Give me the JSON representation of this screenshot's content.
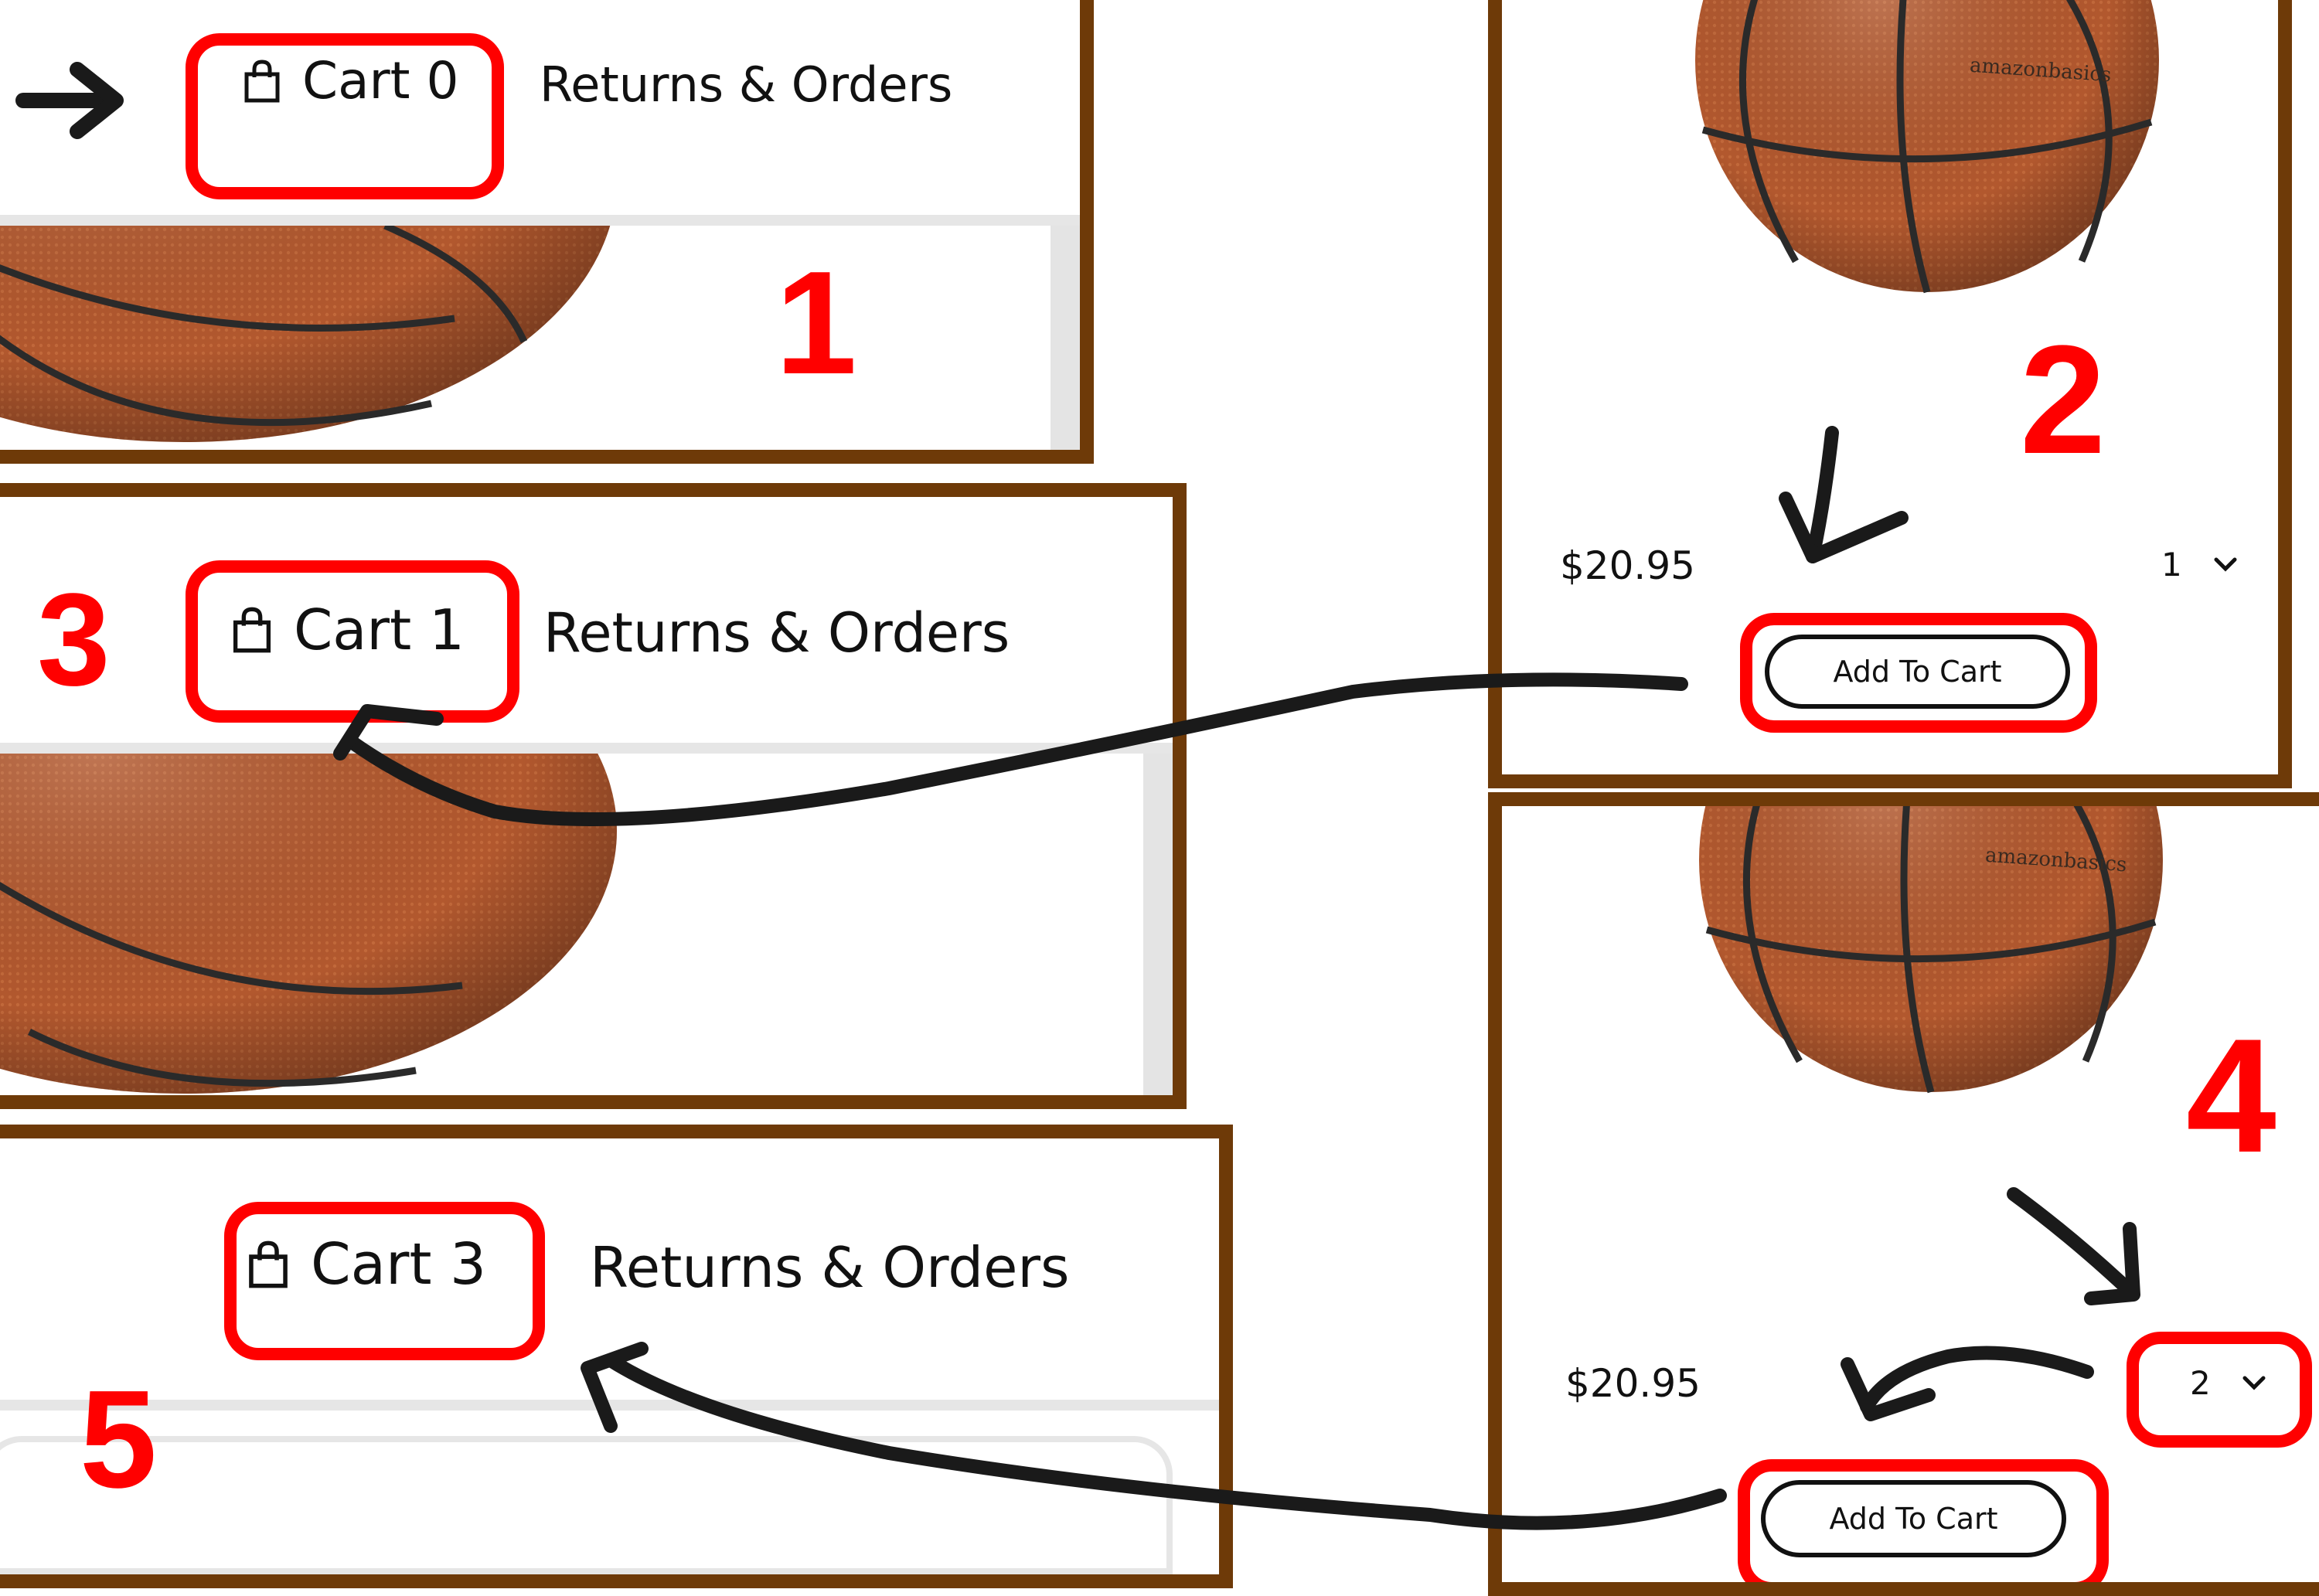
{
  "colors": {
    "frame_border": "#6e3a08",
    "highlight_red": "#ff0000",
    "annotation_ink": "#1a1a1a",
    "ball_orange": "#b2582e",
    "ball_seam": "#2a2a2a",
    "scrollbar": "#e4e4e4"
  },
  "icons": {
    "bag": "shopping-bag-icon",
    "chevron": "chevron-down-icon",
    "arrow": "arrow-right-icon"
  },
  "panel_1": {
    "step_number": "1",
    "cart_label": "Cart 0",
    "returns_label": "Returns & Orders"
  },
  "panel_2": {
    "step_number": "2",
    "brand_text": "amazonbasics",
    "price": "$20.95",
    "quantity": "1",
    "add_to_cart_label": "Add To Cart"
  },
  "panel_3": {
    "step_number": "3",
    "cart_label": "Cart 1",
    "returns_label": "Returns & Orders"
  },
  "panel_4": {
    "step_number": "4",
    "brand_text": "amazonbasics",
    "price": "$20.95",
    "quantity": "2",
    "add_to_cart_label": "Add To Cart"
  },
  "panel_5": {
    "step_number": "5",
    "cart_label": "Cart 3",
    "returns_label": "Returns & Orders"
  }
}
